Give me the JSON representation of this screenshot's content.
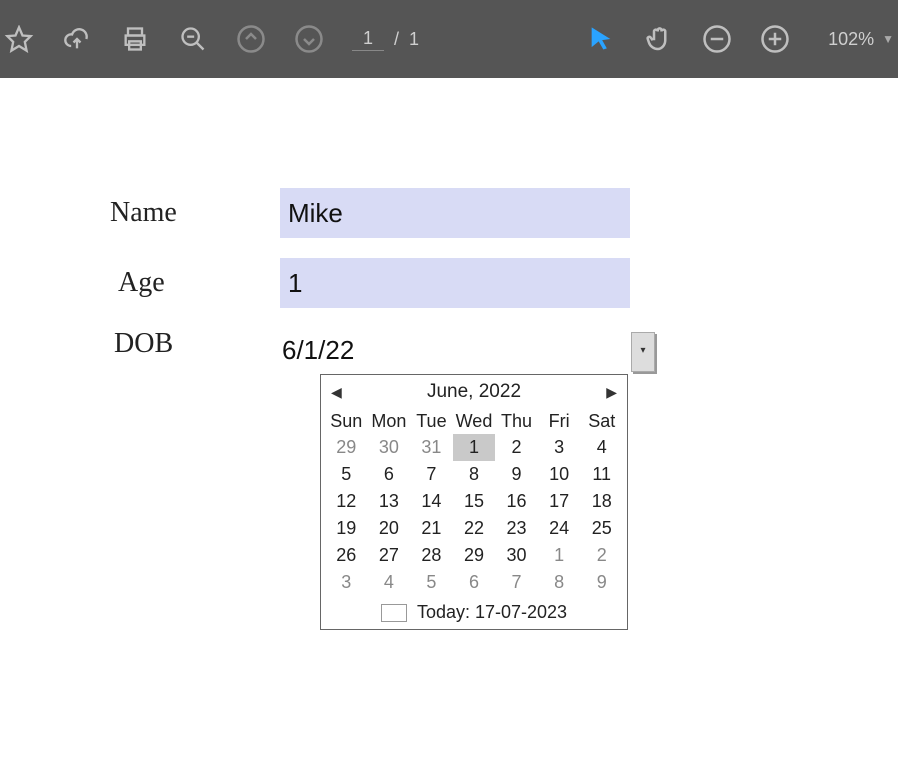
{
  "toolbar": {
    "page_current": "1",
    "page_sep": "/",
    "page_total": "1",
    "zoom": "102%"
  },
  "form": {
    "name_label": "Name",
    "name_value": "Mike",
    "age_label": "Age",
    "age_value": "1",
    "dob_label": "DOB",
    "dob_value": "6/1/22"
  },
  "calendar": {
    "title": "June, 2022",
    "dow": [
      "Sun",
      "Mon",
      "Tue",
      "Wed",
      "Thu",
      "Fri",
      "Sat"
    ],
    "today_label": "Today: 17-07-2023",
    "weeks": [
      [
        {
          "d": "29",
          "o": true
        },
        {
          "d": "30",
          "o": true
        },
        {
          "d": "31",
          "o": true
        },
        {
          "d": "1",
          "sel": true
        },
        {
          "d": "2"
        },
        {
          "d": "3"
        },
        {
          "d": "4"
        }
      ],
      [
        {
          "d": "5"
        },
        {
          "d": "6"
        },
        {
          "d": "7"
        },
        {
          "d": "8"
        },
        {
          "d": "9"
        },
        {
          "d": "10"
        },
        {
          "d": "11"
        }
      ],
      [
        {
          "d": "12"
        },
        {
          "d": "13"
        },
        {
          "d": "14"
        },
        {
          "d": "15"
        },
        {
          "d": "16"
        },
        {
          "d": "17"
        },
        {
          "d": "18"
        }
      ],
      [
        {
          "d": "19"
        },
        {
          "d": "20"
        },
        {
          "d": "21"
        },
        {
          "d": "22"
        },
        {
          "d": "23"
        },
        {
          "d": "24"
        },
        {
          "d": "25"
        }
      ],
      [
        {
          "d": "26"
        },
        {
          "d": "27"
        },
        {
          "d": "28"
        },
        {
          "d": "29"
        },
        {
          "d": "30"
        },
        {
          "d": "1",
          "o": true
        },
        {
          "d": "2",
          "o": true
        }
      ],
      [
        {
          "d": "3",
          "o": true
        },
        {
          "d": "4",
          "o": true
        },
        {
          "d": "5",
          "o": true
        },
        {
          "d": "6",
          "o": true
        },
        {
          "d": "7",
          "o": true
        },
        {
          "d": "8",
          "o": true
        },
        {
          "d": "9",
          "o": true
        }
      ]
    ]
  }
}
